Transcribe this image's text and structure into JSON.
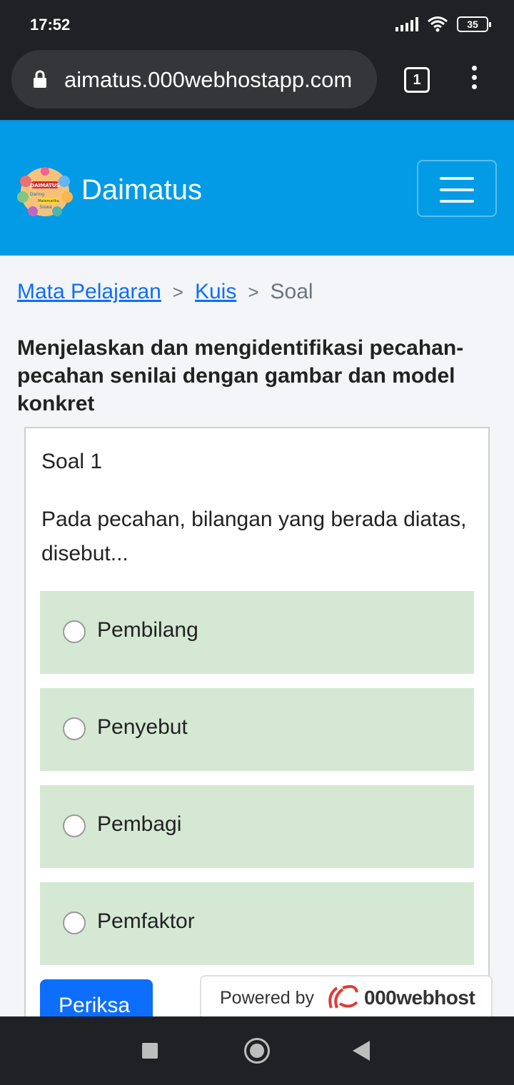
{
  "status_bar": {
    "time": "17:52",
    "battery": "35",
    "icons": [
      "signal-icon",
      "wifi-icon",
      "battery-icon"
    ]
  },
  "browser": {
    "url": "aimatus.000webhostapp.com",
    "tab_count": "1"
  },
  "navbar": {
    "brand": "Daimatus",
    "logo_text": [
      "DAIMATUS",
      "Daring",
      "Matematika",
      "Siswa"
    ],
    "background_color": "#039be5"
  },
  "breadcrumb": {
    "items": [
      "Mata Pelajaran",
      "Kuis"
    ],
    "separator": ">",
    "current": "Soal"
  },
  "page_title": "Menjelaskan dan mengidentifikasi pecahan-pecahan senilai dengan gambar dan model konkret",
  "question": {
    "number_label": "Soal 1",
    "text": "Pada pecahan, bilangan yang berada diatas, disebut...",
    "options": [
      {
        "label": "Pembilang",
        "selected": false
      },
      {
        "label": "Penyebut",
        "selected": false
      },
      {
        "label": "Pembagi",
        "selected": false
      },
      {
        "label": "Pemfaktor",
        "selected": false
      }
    ],
    "option_background": "#d5e8d4",
    "submit_label": "Periksa"
  },
  "powered_badge": {
    "prefix": "Powered by",
    "brand": "000webhost"
  },
  "system_nav": {
    "buttons": [
      "recents-icon",
      "home-icon",
      "back-icon"
    ]
  }
}
